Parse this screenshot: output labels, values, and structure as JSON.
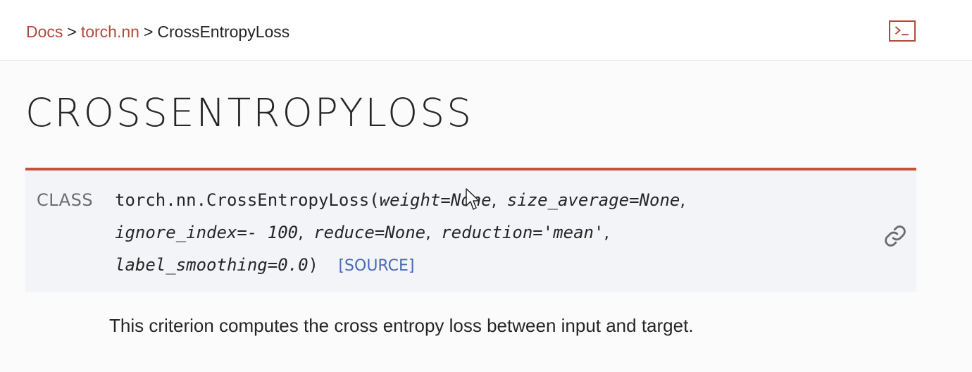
{
  "breadcrumb": {
    "items": [
      "Docs",
      "torch.nn",
      "CrossEntropyLoss"
    ],
    "separator": ">"
  },
  "header": {
    "shell_icon": "terminal-icon"
  },
  "page": {
    "title": "CROSSENTROPYLOSS"
  },
  "signature": {
    "kind": "CLASS",
    "name": "torch.nn.CrossEntropyLoss",
    "open_paren": "(",
    "close_paren": ")",
    "params": [
      "weight=None",
      "size_average=None",
      "ignore_index=- 100",
      "reduce=None",
      "reduction='mean'",
      "label_smoothing=0.0"
    ],
    "comma": ",",
    "source_label": "[SOURCE]",
    "permalink_icon": "link-icon"
  },
  "description": "This criterion computes the cross entropy loss between input and target.",
  "colors": {
    "accent": "#c8503f",
    "link": "#b14a3a",
    "source_link": "#4a6ab4",
    "signature_bg": "#f3f4f7"
  }
}
